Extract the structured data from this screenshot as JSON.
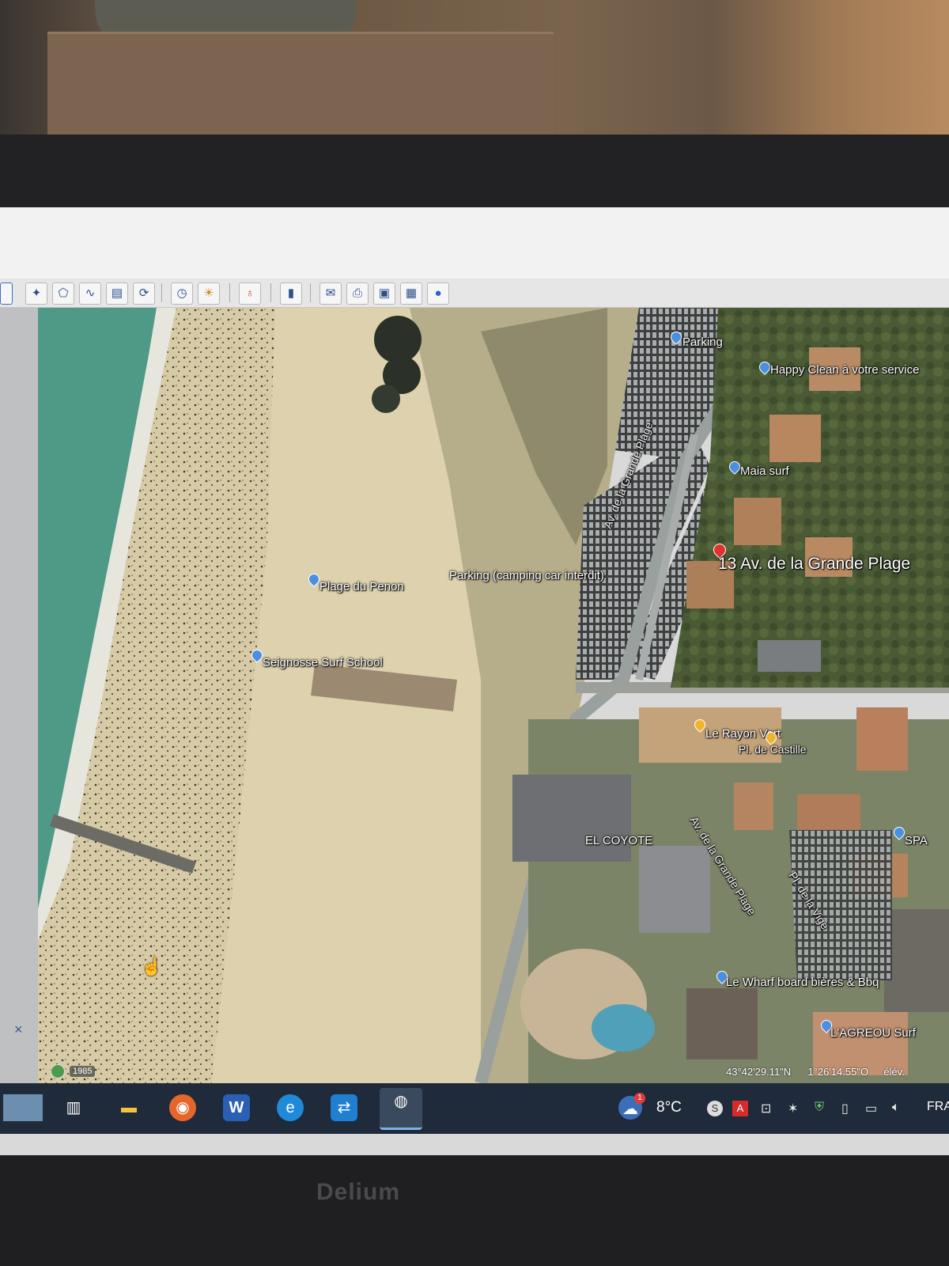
{
  "monitor": {
    "brand": "Delium"
  },
  "toolbar": {
    "buttons": [
      {
        "icon": "placemark-icon",
        "glyph": "✦"
      },
      {
        "icon": "polygon-icon",
        "glyph": "⬠"
      },
      {
        "icon": "path-icon",
        "glyph": "∿"
      },
      {
        "icon": "overlay-icon",
        "glyph": "▤"
      },
      {
        "icon": "tour-icon",
        "glyph": "⟳"
      },
      {
        "icon": "historical-imagery-icon",
        "glyph": "◷"
      },
      {
        "icon": "sunlight-icon",
        "glyph": "☀"
      },
      {
        "icon": "planets-icon",
        "glyph": "♁"
      },
      {
        "icon": "ruler-icon",
        "glyph": "▮"
      },
      {
        "icon": "email-icon",
        "glyph": "✉"
      },
      {
        "icon": "print-icon",
        "glyph": "⎙"
      },
      {
        "icon": "save-image-icon",
        "glyph": "▣"
      },
      {
        "icon": "map-view-icon",
        "glyph": "▦"
      },
      {
        "icon": "earth-globe-icon",
        "glyph": "●"
      }
    ]
  },
  "map": {
    "labels": {
      "parking": "Parking",
      "happy_clean": "Happy Clean à votre service",
      "maia_surf": "Maia surf",
      "address": "13 Av. de la Grande Plage",
      "av_grande_plage_1": "Av. de la Grande Plage",
      "parking_camping": "Parking (camping car interdit)",
      "plage_penon": "Plage du Penon",
      "surf_school": "Seignosse Surf School",
      "rayon_vert": "Le Rayon Vert",
      "pl_castille": "Pl. de Castille",
      "coyote": "EL COYOTE",
      "spa": "SPA",
      "av_grande_plage_2": "Av. de la Grande Plage",
      "pl_vige": "Pl. de la Vige",
      "le_wharf": "Le Wharf board bières & Bbq",
      "agreou": "L'AGREOU Surf"
    },
    "year": "1985",
    "lat": "43°42'29.11\"N",
    "lon": "1°26'14.55\"O",
    "elev_label": "élév."
  },
  "taskbar": {
    "weather_temp": "8°C",
    "weather_badge": "1",
    "language": "FRA"
  },
  "colors": {
    "ocean": "#4f9a86",
    "sand": "#d8cca4",
    "dune": "#b6ad8a",
    "vegetation": "#5f6a45",
    "taskbar": "#1f2a3a"
  }
}
